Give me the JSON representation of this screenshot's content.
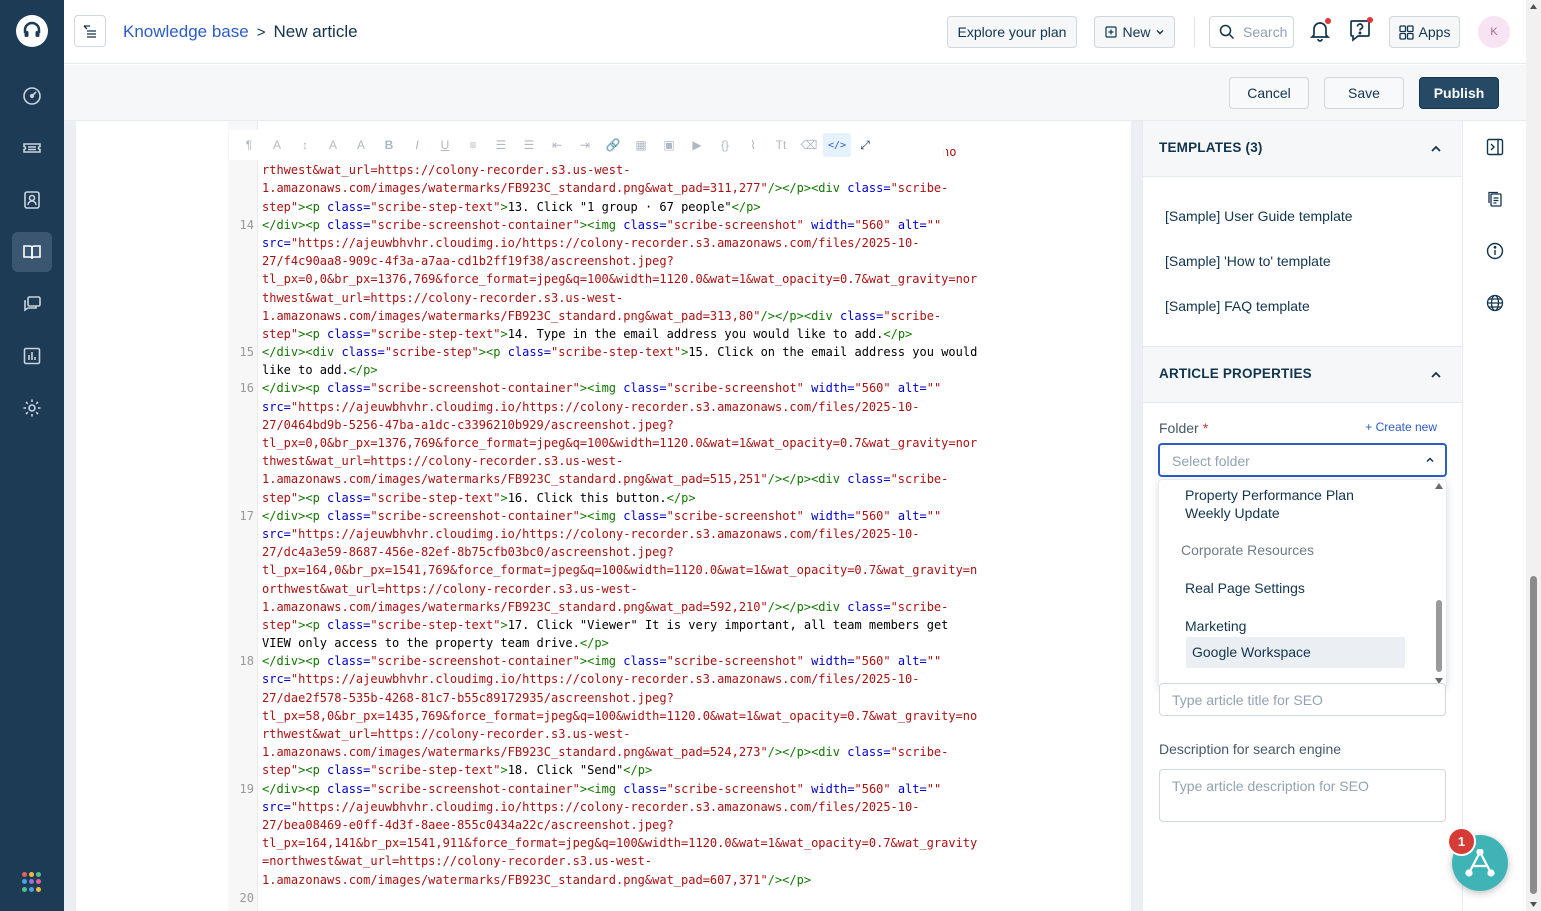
{
  "app": {
    "nav_items": [
      "dashboard",
      "tickets",
      "contacts",
      "solutions",
      "conversations",
      "reports",
      "admin"
    ]
  },
  "header": {
    "breadcrumb_parent": "Knowledge base",
    "breadcrumb_separator": ">",
    "breadcrumb_current": "New article",
    "explore_plan": "Explore your plan",
    "new_label": "New",
    "search_placeholder": "Search",
    "apps_label": "Apps",
    "avatar_initial": "K"
  },
  "actions": {
    "cancel": "Cancel",
    "save": "Save",
    "publish": "Publish"
  },
  "editor": {
    "toolbar_icons": [
      "paragraph-format",
      "text-color",
      "line-height",
      "font-color",
      "background-color",
      "bold",
      "italic",
      "underline",
      "align",
      "ordered-list",
      "unordered-list",
      "outdent",
      "indent",
      "link",
      "table",
      "image",
      "video",
      "code-block",
      "attachment",
      "tag",
      "clear-format",
      "code-view",
      "fullscreen"
    ],
    "lines": [
      {
        "n": "",
        "parts": [
          [
            "",
            "no"
          ]
        ]
      },
      {
        "n": "",
        "parts": [
          [
            "s",
            "rthwest&wat_url=https://colony-recorder.s3.us-west-"
          ]
        ]
      },
      {
        "n": "",
        "parts": [
          [
            "s",
            "1.amazonaws.com/images/watermarks/FB923C_standard.png&wat_pad=311,277\""
          ],
          [
            "t",
            "/></p><div"
          ],
          [
            "",
            " "
          ],
          [
            "a",
            "class="
          ],
          [
            "s",
            "\"scribe-"
          ]
        ]
      },
      {
        "n": "",
        "parts": [
          [
            "s",
            "step\""
          ],
          [
            "t",
            "><p"
          ],
          [
            "",
            " "
          ],
          [
            "a",
            "class="
          ],
          [
            "s",
            "\"scribe-step-text\""
          ],
          [
            "t",
            ">"
          ],
          [
            "",
            "13. Click \"1 group · 67 people\""
          ],
          [
            "t",
            "</p>"
          ]
        ]
      },
      {
        "n": "14",
        "parts": [
          [
            "t",
            "</div><p"
          ],
          [
            "",
            " "
          ],
          [
            "a",
            "class="
          ],
          [
            "s",
            "\"scribe-screenshot-container\""
          ],
          [
            "t",
            "><img"
          ],
          [
            "",
            " "
          ],
          [
            "a",
            "class="
          ],
          [
            "s",
            "\"scribe-screenshot\""
          ],
          [
            "",
            " "
          ],
          [
            "a",
            "width="
          ],
          [
            "s",
            "\"560\""
          ],
          [
            "",
            " "
          ],
          [
            "a",
            "alt="
          ],
          [
            "s",
            "\"\""
          ]
        ]
      },
      {
        "n": "",
        "parts": [
          [
            "a",
            "src="
          ],
          [
            "s",
            "\"https://ajeuwbhvhr.cloudimg.io/https://colony-recorder.s3.amazonaws.com/files/2025-10-"
          ]
        ]
      },
      {
        "n": "",
        "parts": [
          [
            "s",
            "27/f4c90aa8-909c-4f3a-a7aa-cd1b2ff19f38/ascreenshot.jpeg?"
          ]
        ]
      },
      {
        "n": "",
        "parts": [
          [
            "s",
            "tl_px=0,0&br_px=1376,769&force_format=jpeg&q=100&width=1120.0&wat=1&wat_opacity=0.7&wat_gravity=nor"
          ]
        ]
      },
      {
        "n": "",
        "parts": [
          [
            "s",
            "thwest&wat_url=https://colony-recorder.s3.us-west-"
          ]
        ]
      },
      {
        "n": "",
        "parts": [
          [
            "s",
            "1.amazonaws.com/images/watermarks/FB923C_standard.png&wat_pad=313,80\""
          ],
          [
            "t",
            "/></p><div"
          ],
          [
            "",
            " "
          ],
          [
            "a",
            "class="
          ],
          [
            "s",
            "\"scribe-"
          ]
        ]
      },
      {
        "n": "",
        "parts": [
          [
            "s",
            "step\""
          ],
          [
            "t",
            "><p"
          ],
          [
            "",
            " "
          ],
          [
            "a",
            "class="
          ],
          [
            "s",
            "\"scribe-step-text\""
          ],
          [
            "t",
            ">"
          ],
          [
            "",
            "14. Type in the email address you would like to add."
          ],
          [
            "t",
            "</p>"
          ]
        ]
      },
      {
        "n": "15",
        "parts": [
          [
            "t",
            "</div><div"
          ],
          [
            "",
            " "
          ],
          [
            "a",
            "class="
          ],
          [
            "s",
            "\"scribe-step\""
          ],
          [
            "t",
            "><p"
          ],
          [
            "",
            " "
          ],
          [
            "a",
            "class="
          ],
          [
            "s",
            "\"scribe-step-text\""
          ],
          [
            "t",
            ">"
          ],
          [
            "",
            "15. Click on the email address you would"
          ]
        ]
      },
      {
        "n": "",
        "parts": [
          [
            "",
            "like to add."
          ],
          [
            "t",
            "</p>"
          ]
        ]
      },
      {
        "n": "16",
        "parts": [
          [
            "t",
            "</div><p"
          ],
          [
            "",
            " "
          ],
          [
            "a",
            "class="
          ],
          [
            "s",
            "\"scribe-screenshot-container\""
          ],
          [
            "t",
            "><img"
          ],
          [
            "",
            " "
          ],
          [
            "a",
            "class="
          ],
          [
            "s",
            "\"scribe-screenshot\""
          ],
          [
            "",
            " "
          ],
          [
            "a",
            "width="
          ],
          [
            "s",
            "\"560\""
          ],
          [
            "",
            " "
          ],
          [
            "a",
            "alt="
          ],
          [
            "s",
            "\"\""
          ]
        ]
      },
      {
        "n": "",
        "parts": [
          [
            "a",
            "src="
          ],
          [
            "s",
            "\"https://ajeuwbhvhr.cloudimg.io/https://colony-recorder.s3.amazonaws.com/files/2025-10-"
          ]
        ]
      },
      {
        "n": "",
        "parts": [
          [
            "s",
            "27/0464bd9b-5256-47ba-a1dc-c3396210b929/ascreenshot.jpeg?"
          ]
        ]
      },
      {
        "n": "",
        "parts": [
          [
            "s",
            "tl_px=0,0&br_px=1376,769&force_format=jpeg&q=100&width=1120.0&wat=1&wat_opacity=0.7&wat_gravity=nor"
          ]
        ]
      },
      {
        "n": "",
        "parts": [
          [
            "s",
            "thwest&wat_url=https://colony-recorder.s3.us-west-"
          ]
        ]
      },
      {
        "n": "",
        "parts": [
          [
            "s",
            "1.amazonaws.com/images/watermarks/FB923C_standard.png&wat_pad=515,251\""
          ],
          [
            "t",
            "/></p><div"
          ],
          [
            "",
            " "
          ],
          [
            "a",
            "class="
          ],
          [
            "s",
            "\"scribe-"
          ]
        ]
      },
      {
        "n": "",
        "parts": [
          [
            "s",
            "step\""
          ],
          [
            "t",
            "><p"
          ],
          [
            "",
            " "
          ],
          [
            "a",
            "class="
          ],
          [
            "s",
            "\"scribe-step-text\""
          ],
          [
            "t",
            ">"
          ],
          [
            "",
            "16. Click this button."
          ],
          [
            "t",
            "</p>"
          ]
        ]
      },
      {
        "n": "17",
        "parts": [
          [
            "t",
            "</div><p"
          ],
          [
            "",
            " "
          ],
          [
            "a",
            "class="
          ],
          [
            "s",
            "\"scribe-screenshot-container\""
          ],
          [
            "t",
            "><img"
          ],
          [
            "",
            " "
          ],
          [
            "a",
            "class="
          ],
          [
            "s",
            "\"scribe-screenshot\""
          ],
          [
            "",
            " "
          ],
          [
            "a",
            "width="
          ],
          [
            "s",
            "\"560\""
          ],
          [
            "",
            " "
          ],
          [
            "a",
            "alt="
          ],
          [
            "s",
            "\"\""
          ]
        ]
      },
      {
        "n": "",
        "parts": [
          [
            "a",
            "src="
          ],
          [
            "s",
            "\"https://ajeuwbhvhr.cloudimg.io/https://colony-recorder.s3.amazonaws.com/files/2025-10-"
          ]
        ]
      },
      {
        "n": "",
        "parts": [
          [
            "s",
            "27/dc4a3e59-8687-456e-82ef-8b75cfb03bc0/ascreenshot.jpeg?"
          ]
        ]
      },
      {
        "n": "",
        "parts": [
          [
            "s",
            "tl_px=164,0&br_px=1541,769&force_format=jpeg&q=100&width=1120.0&wat=1&wat_opacity=0.7&wat_gravity=n"
          ]
        ]
      },
      {
        "n": "",
        "parts": [
          [
            "s",
            "orthwest&wat_url=https://colony-recorder.s3.us-west-"
          ]
        ]
      },
      {
        "n": "",
        "parts": [
          [
            "s",
            "1.amazonaws.com/images/watermarks/FB923C_standard.png&wat_pad=592,210\""
          ],
          [
            "t",
            "/></p><div"
          ],
          [
            "",
            " "
          ],
          [
            "a",
            "class="
          ],
          [
            "s",
            "\"scribe-"
          ]
        ]
      },
      {
        "n": "",
        "parts": [
          [
            "s",
            "step\""
          ],
          [
            "t",
            "><p"
          ],
          [
            "",
            " "
          ],
          [
            "a",
            "class="
          ],
          [
            "s",
            "\"scribe-step-text\""
          ],
          [
            "t",
            ">"
          ],
          [
            "",
            "17. Click \"Viewer\" It is very important, all team members get"
          ]
        ]
      },
      {
        "n": "",
        "parts": [
          [
            "",
            "VIEW only access to the property team drive."
          ],
          [
            "t",
            "</p>"
          ]
        ]
      },
      {
        "n": "18",
        "parts": [
          [
            "t",
            "</div><p"
          ],
          [
            "",
            " "
          ],
          [
            "a",
            "class="
          ],
          [
            "s",
            "\"scribe-screenshot-container\""
          ],
          [
            "t",
            "><img"
          ],
          [
            "",
            " "
          ],
          [
            "a",
            "class="
          ],
          [
            "s",
            "\"scribe-screenshot\""
          ],
          [
            "",
            " "
          ],
          [
            "a",
            "width="
          ],
          [
            "s",
            "\"560\""
          ],
          [
            "",
            " "
          ],
          [
            "a",
            "alt="
          ],
          [
            "s",
            "\"\""
          ]
        ]
      },
      {
        "n": "",
        "parts": [
          [
            "a",
            "src="
          ],
          [
            "s",
            "\"https://ajeuwbhvhr.cloudimg.io/https://colony-recorder.s3.amazonaws.com/files/2025-10-"
          ]
        ]
      },
      {
        "n": "",
        "parts": [
          [
            "s",
            "27/dae2f578-535b-4268-81c7-b55c89172935/ascreenshot.jpeg?"
          ]
        ]
      },
      {
        "n": "",
        "parts": [
          [
            "s",
            "tl_px=58,0&br_px=1435,769&force_format=jpeg&q=100&width=1120.0&wat=1&wat_opacity=0.7&wat_gravity=no"
          ]
        ]
      },
      {
        "n": "",
        "parts": [
          [
            "s",
            "rthwest&wat_url=https://colony-recorder.s3.us-west-"
          ]
        ]
      },
      {
        "n": "",
        "parts": [
          [
            "s",
            "1.amazonaws.com/images/watermarks/FB923C_standard.png&wat_pad=524,273\""
          ],
          [
            "t",
            "/></p><div"
          ],
          [
            "",
            " "
          ],
          [
            "a",
            "class="
          ],
          [
            "s",
            "\"scribe-"
          ]
        ]
      },
      {
        "n": "",
        "parts": [
          [
            "s",
            "step\""
          ],
          [
            "t",
            "><p"
          ],
          [
            "",
            " "
          ],
          [
            "a",
            "class="
          ],
          [
            "s",
            "\"scribe-step-text\""
          ],
          [
            "t",
            ">"
          ],
          [
            "",
            "18. Click \"Send\""
          ],
          [
            "t",
            "</p>"
          ]
        ]
      },
      {
        "n": "19",
        "parts": [
          [
            "t",
            "</div><p"
          ],
          [
            "",
            " "
          ],
          [
            "a",
            "class="
          ],
          [
            "s",
            "\"scribe-screenshot-container\""
          ],
          [
            "t",
            "><img"
          ],
          [
            "",
            " "
          ],
          [
            "a",
            "class="
          ],
          [
            "s",
            "\"scribe-screenshot\""
          ],
          [
            "",
            " "
          ],
          [
            "a",
            "width="
          ],
          [
            "s",
            "\"560\""
          ],
          [
            "",
            " "
          ],
          [
            "a",
            "alt="
          ],
          [
            "s",
            "\"\""
          ]
        ]
      },
      {
        "n": "",
        "parts": [
          [
            "a",
            "src="
          ],
          [
            "s",
            "\"https://ajeuwbhvhr.cloudimg.io/https://colony-recorder.s3.amazonaws.com/files/2025-10-"
          ]
        ]
      },
      {
        "n": "",
        "parts": [
          [
            "s",
            "27/bea08469-e0ff-4d3f-8aee-855c0434a22c/ascreenshot.jpeg?"
          ]
        ]
      },
      {
        "n": "",
        "parts": [
          [
            "s",
            "tl_px=164,141&br_px=1541,911&force_format=jpeg&q=100&width=1120.0&wat=1&wat_opacity=0.7&wat_gravity"
          ]
        ]
      },
      {
        "n": "",
        "parts": [
          [
            "s",
            "=northwest&wat_url=https://colony-recorder.s3.us-west-"
          ]
        ]
      },
      {
        "n": "",
        "parts": [
          [
            "s",
            "1.amazonaws.com/images/watermarks/FB923C_standard.png&wat_pad=607,371\""
          ],
          [
            "t",
            "/></p>"
          ]
        ]
      },
      {
        "n": "20",
        "parts": [
          [
            "",
            ""
          ]
        ]
      }
    ]
  },
  "templates": {
    "title": "TEMPLATES (3)",
    "items": [
      "[Sample] User Guide template",
      "[Sample] 'How to' template",
      "[Sample] FAQ template"
    ]
  },
  "properties": {
    "title": "ARTICLE PROPERTIES",
    "folder_label": "Folder",
    "required_mark": "*",
    "create_new": "+ Create new",
    "folder_placeholder": "Select folder",
    "dropdown": {
      "item1_line1": "Property Performance Plan",
      "item1_line2": "Weekly Update",
      "group": "Corporate Resources",
      "items": [
        "Real Page Settings",
        "Marketing",
        "Google Workspace"
      ],
      "selected": "Google Workspace"
    },
    "seo_title_placeholder": "Type article title for SEO",
    "seo_desc_label": "Description for search engine",
    "seo_desc_placeholder": "Type article description for SEO"
  },
  "chat": {
    "badge_count": "1"
  },
  "colors": {
    "nav_bg": "#1d3b55",
    "primary": "#264966",
    "link": "#2c5cc5",
    "accent_teal": "#3fb4b6",
    "badge_red": "#d63b36"
  }
}
